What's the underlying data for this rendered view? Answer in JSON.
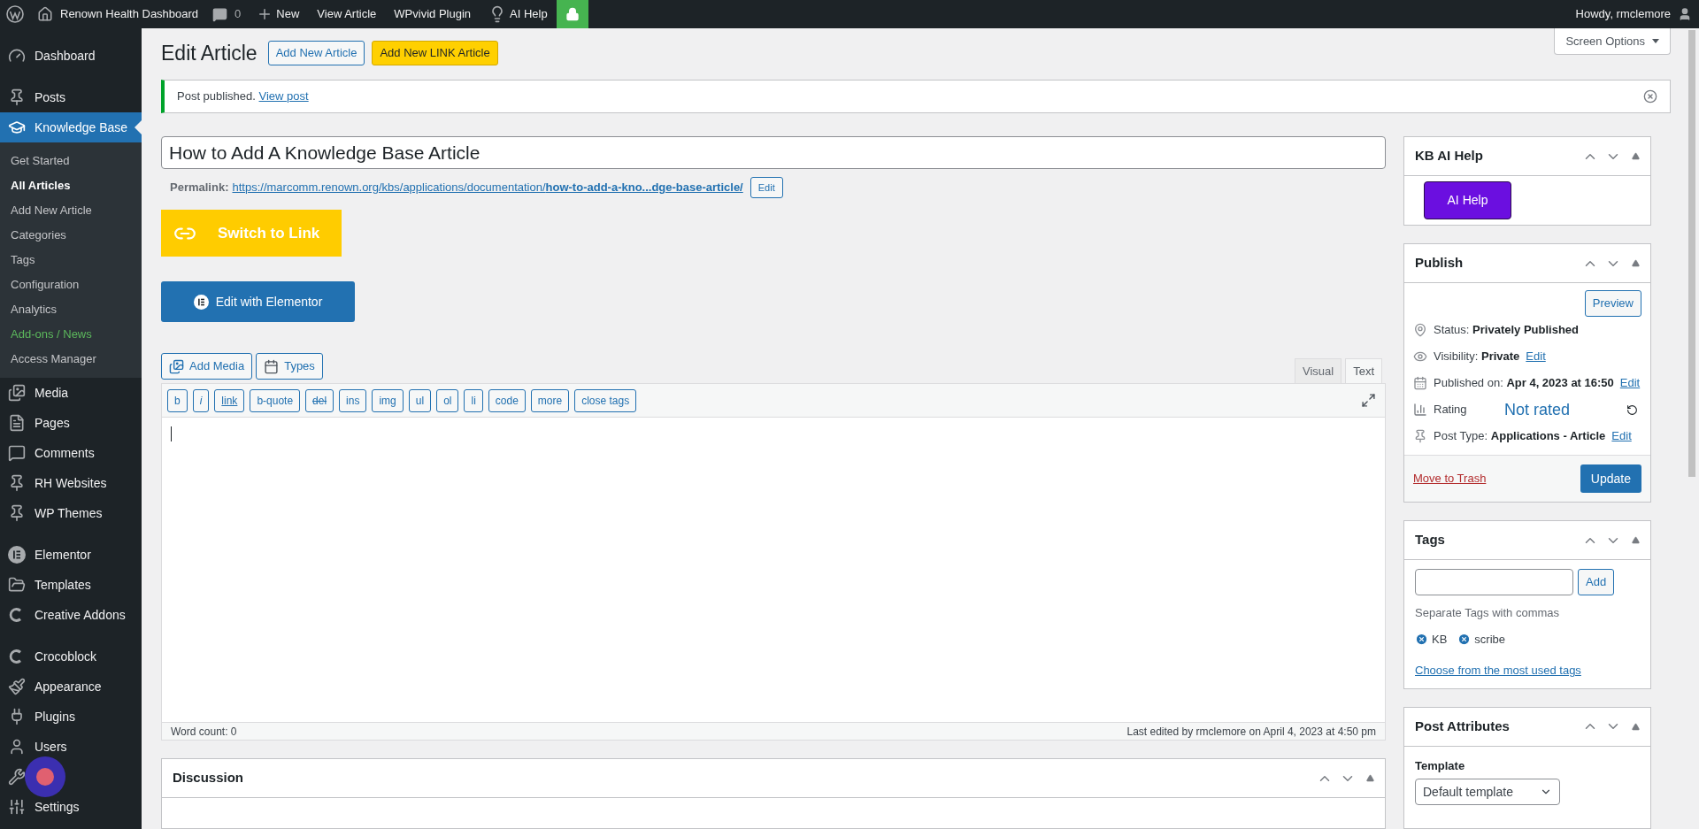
{
  "admin_bar": {
    "site": "Renown Health Dashboard",
    "comments": "0",
    "items": [
      "New",
      "View Article",
      "WPvivid Plugin",
      "AI Help"
    ],
    "greeting": "Howdy, rmclemore"
  },
  "sidebar": {
    "groups": [
      [
        {
          "label": "Dashboard",
          "selected": false
        }
      ],
      [
        {
          "label": "Posts",
          "selected": false
        },
        {
          "label": "Knowledge Base",
          "selected": true,
          "submenu": [
            {
              "label": "Get Started",
              "selected": false,
              "kind": "normal"
            },
            {
              "label": "All Articles",
              "selected": true,
              "kind": "normal"
            },
            {
              "label": "Add New Article",
              "selected": false,
              "kind": "normal"
            },
            {
              "label": "Categories",
              "selected": false,
              "kind": "normal"
            },
            {
              "label": "Tags",
              "selected": false,
              "kind": "normal"
            },
            {
              "label": "Configuration",
              "selected": false,
              "kind": "normal"
            },
            {
              "label": "Analytics",
              "selected": false,
              "kind": "normal"
            },
            {
              "label": "Add-ons / News",
              "selected": false,
              "kind": "promo"
            },
            {
              "label": "Access Manager",
              "selected": false,
              "kind": "normal"
            }
          ]
        },
        {
          "label": "Media",
          "selected": false
        },
        {
          "label": "Pages",
          "selected": false
        },
        {
          "label": "Comments",
          "selected": false
        },
        {
          "label": "RH Websites",
          "selected": false
        },
        {
          "label": "WP Themes",
          "selected": false
        }
      ],
      [
        {
          "label": "Elementor",
          "selected": false
        },
        {
          "label": "Templates",
          "selected": false
        },
        {
          "label": "Creative Addons",
          "selected": false
        }
      ],
      [
        {
          "label": "Crocoblock",
          "selected": false
        },
        {
          "label": "Appearance",
          "selected": false
        },
        {
          "label": "Plugins",
          "selected": false
        },
        {
          "label": "Users",
          "selected": false
        },
        {
          "selected": false
        },
        {
          "label": "Settings",
          "selected": false
        }
      ]
    ]
  },
  "header": {
    "title": "Edit Article",
    "buttons": [
      {
        "label": "Add New Article",
        "kind": "outline"
      },
      {
        "label": "Add New LINK Article",
        "kind": "yellow"
      }
    ],
    "screen_options": "Screen Options"
  },
  "notice": {
    "text": "Post published.",
    "link": "View post"
  },
  "post_title": "How to Add A Knowledge Base Article",
  "permalink": {
    "label": "Permalink:",
    "url_start": "https://marcomm.renown.org/kbs/applications/documentation/",
    "url_slug": "how-to-add-a-kno...dge-base-article/",
    "edit": "Edit"
  },
  "switch_button": "Switch to Link",
  "elementor_button": "Edit with Elementor",
  "media_buttons": [
    "Add Media",
    "Types"
  ],
  "editor_tabs": [
    {
      "label": "Visual",
      "selected": false
    },
    {
      "label": "Text",
      "selected": true
    }
  ],
  "quicktags": [
    "b",
    "i",
    "link",
    "b-quote",
    "del",
    "ins",
    "img",
    "ul",
    "ol",
    "li",
    "code",
    "more",
    "close tags"
  ],
  "word_count": "Word count: 0",
  "last_edited": "Last edited by rmclemore on April 4, 2023 at 4:50 pm",
  "discussion": {
    "title": "Discussion"
  },
  "kb_ai_help": {
    "title": "KB AI Help",
    "button": "AI Help"
  },
  "publish": {
    "title": "Publish",
    "preview": "Preview",
    "rows": [
      {
        "label": "Status:",
        "value": "Privately Published"
      },
      {
        "label": "Visibility:",
        "value": "Private",
        "edit": "Edit"
      },
      {
        "label": "Published on:",
        "value": "Apr 4, 2023 at 16:50",
        "edit": "Edit"
      },
      {
        "label": "Post Type:",
        "value": "Applications - Article",
        "edit": "Edit"
      }
    ],
    "rating": {
      "label": "Rating",
      "value": "Not rated"
    },
    "trash": "Move to Trash",
    "update": "Update"
  },
  "tags": {
    "title": "Tags",
    "add": "Add",
    "hint": "Separate Tags with commas",
    "items": [
      "KB",
      "scribe"
    ],
    "choose": "Choose from the most used tags"
  },
  "post_attributes": {
    "title": "Post Attributes",
    "template_label": "Template",
    "template": "Default template"
  }
}
